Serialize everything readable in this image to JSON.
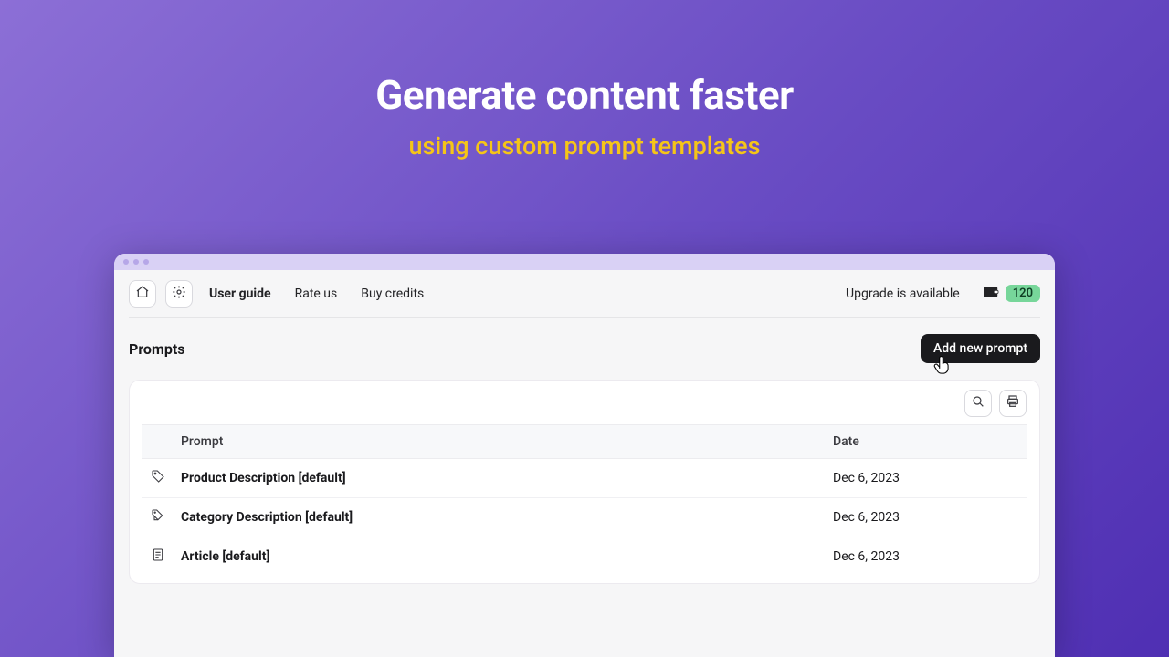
{
  "hero": {
    "title": "Generate content faster",
    "subtitle": "using custom prompt templates"
  },
  "toolbar": {
    "home_icon": "home-icon",
    "settings_icon": "gear-icon",
    "links": {
      "user_guide": "User guide",
      "rate_us": "Rate us",
      "buy_credits": "Buy credits"
    },
    "upgrade_text": "Upgrade is available",
    "credits_balance": "120"
  },
  "page": {
    "title": "Prompts",
    "add_button": "Add new prompt"
  },
  "table": {
    "headers": {
      "name": "Prompt",
      "date": "Date"
    },
    "rows": [
      {
        "icon": "tag-icon",
        "name": "Product Description [default]",
        "date": "Dec 6, 2023"
      },
      {
        "icon": "tags-icon",
        "name": "Category Description [default]",
        "date": "Dec 6, 2023"
      },
      {
        "icon": "document-icon",
        "name": "Article [default]",
        "date": "Dec 6, 2023"
      }
    ]
  },
  "colors": {
    "accent": "#77d69a",
    "highlight": "#f5c518"
  }
}
